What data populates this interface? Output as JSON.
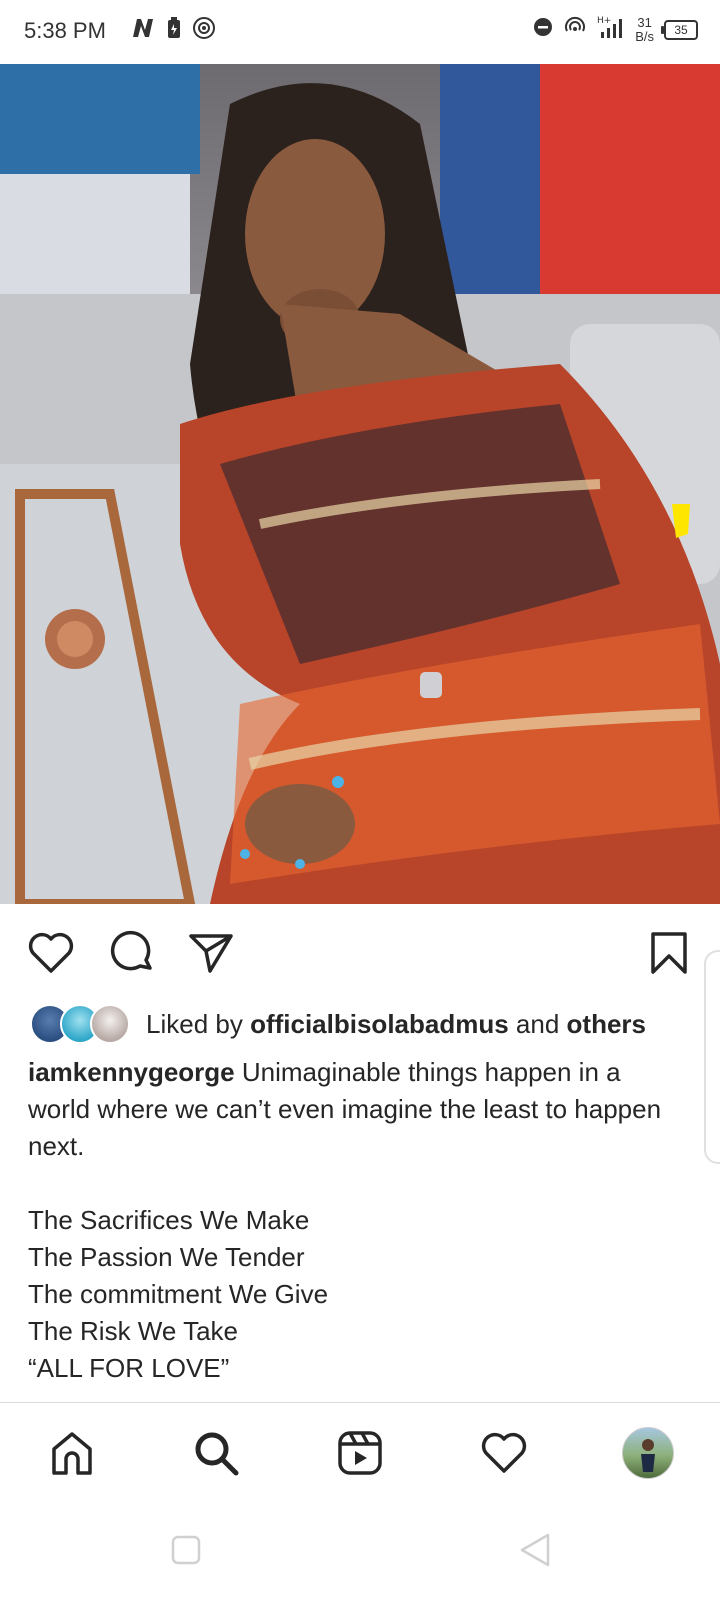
{
  "status_bar": {
    "time": "5:38 PM",
    "network_speed_value": "31",
    "network_speed_unit": "B/s",
    "network_type": "H+",
    "battery_level": "35"
  },
  "post": {
    "image_description_icon": "photo",
    "likes": {
      "prefix": "Liked by",
      "user": "officialbisolabadmus",
      "and": "and",
      "others": "others"
    },
    "caption": {
      "username": "iamkennygeorge",
      "text": "Unimaginable things happen in a world where we can’t even imagine the least to happen next.",
      "lines": [
        "The Sacrifices We Make",
        "The Passion We Tender",
        "The commitment We Give",
        "The Risk We Take",
        "“ALL FOR LOVE”"
      ]
    }
  },
  "icons": {
    "like": "heart-icon",
    "comment": "comment-icon",
    "share": "send-icon",
    "save": "bookmark-icon",
    "home": "home-icon",
    "search": "search-icon",
    "reels": "reels-icon",
    "activity": "heart-icon",
    "profile": "avatar"
  },
  "colors": {
    "text": "#262626",
    "divider": "#dbdbdb",
    "background": "#ffffff"
  }
}
